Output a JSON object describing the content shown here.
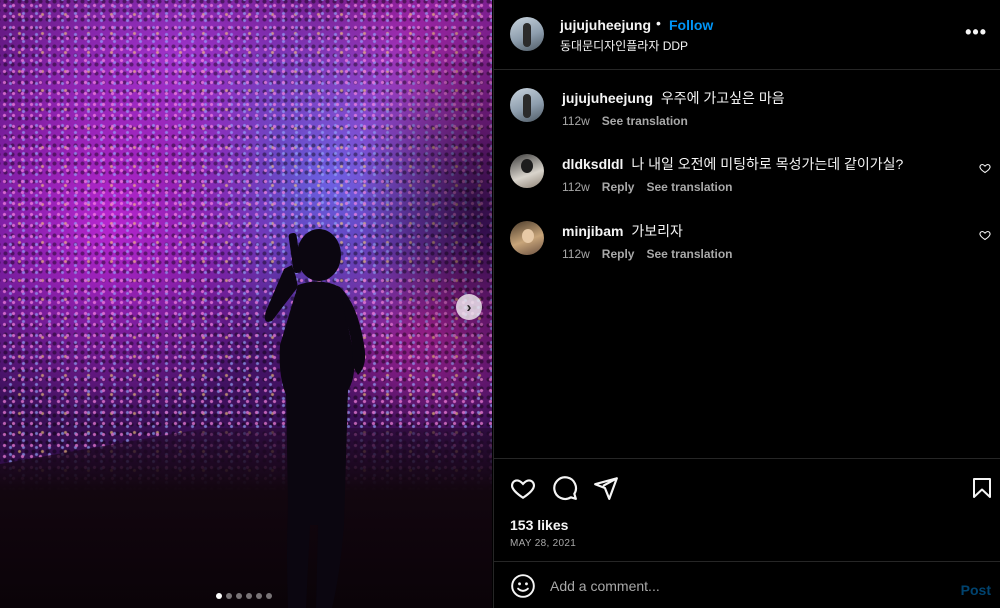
{
  "post": {
    "author": "jujujuheejung",
    "separator": "•",
    "follow_label": "Follow",
    "location": "동대문디자인플라자 DDP",
    "more_icon": "more-options-icon",
    "more_glyph": "•••"
  },
  "media": {
    "next_icon": "chevron-right-icon",
    "next_glyph": "›",
    "carousel_count": 6,
    "carousel_active": 0
  },
  "comments": [
    {
      "username": "jujujuheejung",
      "text": "우주에 가고싶은 마음",
      "time": "112w",
      "reply_label": "",
      "translate_label": "See translation",
      "has_like": false
    },
    {
      "username": "dldksdldl",
      "text": "나 내일 오전에 미팅하로 목성가는데 같이가실?",
      "time": "112w",
      "reply_label": "Reply",
      "translate_label": "See translation",
      "has_like": true
    },
    {
      "username": "minjibam",
      "text": "가보리자",
      "time": "112w",
      "reply_label": "Reply",
      "translate_label": "See translation",
      "has_like": true
    }
  ],
  "actions": {
    "like_icon": "heart-icon",
    "comment_icon": "comment-icon",
    "share_icon": "send-icon",
    "save_icon": "bookmark-icon",
    "likes": "153 likes",
    "date": "MAY 28, 2021"
  },
  "composer": {
    "emoji_icon": "emoji-icon",
    "placeholder": "Add a comment...",
    "post_label": "Post"
  },
  "colors": {
    "background": "#000000",
    "text": "#f5f5f5",
    "secondary_text": "#a8a8a8",
    "link_blue": "#0095f6",
    "divider": "#262626"
  }
}
